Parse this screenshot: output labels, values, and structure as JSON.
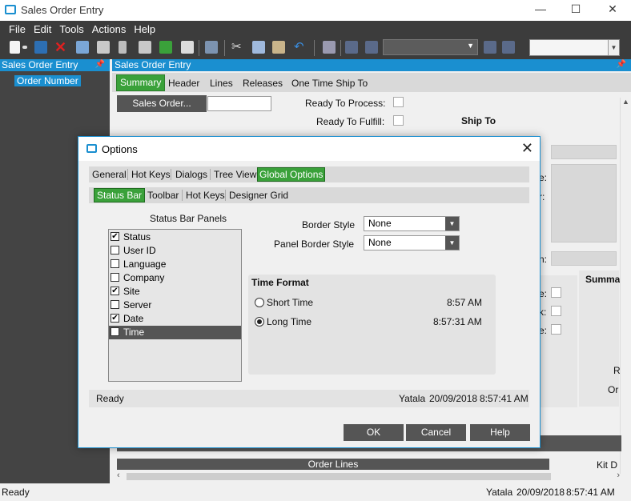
{
  "window": {
    "title": "Sales Order Entry",
    "minimize": "—",
    "maximize": "☐",
    "close": "✕"
  },
  "menu": [
    "File",
    "Edit",
    "Tools",
    "Actions",
    "Help"
  ],
  "left_panel": {
    "header": "Sales Order Entry",
    "item": "Order Number"
  },
  "main": {
    "header": "Sales Order Entry",
    "tabs": [
      "Summary",
      "Header",
      "Lines",
      "Releases",
      "One Time Ship To"
    ],
    "sales_order_button": "Sales Order...",
    "ready_to_process": "Ready To Process:",
    "ready_to_fulfill": "Ready To Fulfill:",
    "ship_to": "Ship To",
    "summary_label": "Summa",
    "order_lines": "Order Lines",
    "kit_label": "Kit D",
    "partial_labels": [
      "e:",
      "r:",
      "n:",
      "e:",
      "k:",
      "e:",
      "R",
      "Or"
    ]
  },
  "status_bar": {
    "status": "Ready",
    "user": "Yatala",
    "date": "20/09/2018",
    "time": "8:57:41 AM"
  },
  "dialog": {
    "title": "Options",
    "close": "✕",
    "tabs": [
      "General",
      "Hot Keys",
      "Dialogs",
      "Tree View",
      "Global Options"
    ],
    "subtabs": [
      "Status Bar",
      "Toolbar",
      "Hot Keys",
      "Designer Grid"
    ],
    "panels_title": "Status Bar Panels",
    "panels": [
      {
        "label": "Status",
        "checked": true
      },
      {
        "label": "User ID",
        "checked": false
      },
      {
        "label": "Language",
        "checked": false
      },
      {
        "label": "Company",
        "checked": false
      },
      {
        "label": "Site",
        "checked": true
      },
      {
        "label": "Server",
        "checked": false
      },
      {
        "label": "Date",
        "checked": true
      },
      {
        "label": "Time",
        "checked": true
      }
    ],
    "border_style_label": "Border Style",
    "border_style_value": "None",
    "panel_border_style_label": "Panel Border Style",
    "panel_border_style_value": "None",
    "time_format_title": "Time Format",
    "short_time_label": "Short Time",
    "short_time_value": "8:57 AM",
    "long_time_label": "Long Time",
    "long_time_value": "8:57:31 AM",
    "preview_status": {
      "status": "Ready",
      "user": "Yatala",
      "date": "20/09/2018",
      "time": "8:57:41 AM"
    },
    "buttons": {
      "ok": "OK",
      "cancel": "Cancel",
      "help": "Help"
    }
  },
  "colors": {
    "accent_blue": "#1a8fd0",
    "active_tab_green": "#3aa13a",
    "dark_bg": "#3c3c3c"
  }
}
